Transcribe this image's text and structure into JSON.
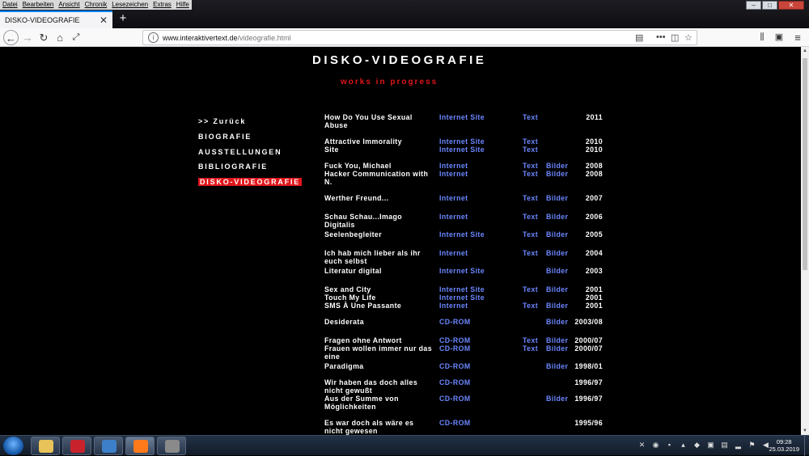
{
  "menubar": [
    "Datei",
    "Bearbeiten",
    "Ansicht",
    "Chronik",
    "Lesezeichen",
    "Extras",
    "Hilfe"
  ],
  "tab": {
    "title": "DISKO-VIDEOGRAFIE",
    "close": "✕"
  },
  "newtab": "+",
  "url": {
    "host": "www.interaktivertext.de",
    "path": "/videografie.html"
  },
  "page": {
    "title": "DISKO-VIDEOGRAFIE",
    "subtitle": "works in progress"
  },
  "sidenav": [
    {
      "label": ">> Zurück",
      "active": false
    },
    {
      "label": "BIOGRAFIE",
      "active": false
    },
    {
      "label": "AUSSTELLUNGEN",
      "active": false
    },
    {
      "label": "BIBLIOGRAFIE",
      "active": false
    },
    {
      "label": "DISKO-VIDEOGRAFIE",
      "active": true
    }
  ],
  "entries": [
    {
      "title": "How Do You Use Sexual Abuse",
      "media": "Internet Site",
      "text": "Text",
      "images": "",
      "year": "2011"
    },
    {
      "title": "Attractive Immorality",
      "media": "Internet Site",
      "text": "Text",
      "images": "",
      "year": "2010"
    },
    {
      "title": "Site",
      "media": "Internet Site",
      "text": "Text",
      "images": "",
      "year": "2010"
    },
    {
      "title": "Fuck You, Michael",
      "media": "Internet",
      "text": "Text",
      "images": "Bilder",
      "year": "2008"
    },
    {
      "title": "Hacker Communication with N.",
      "media": "Internet",
      "text": "Text",
      "images": "Bilder",
      "year": "2008"
    },
    {
      "title": "Werther Freund...",
      "media": "Internet",
      "text": "Text",
      "images": "Bilder",
      "year": "2007"
    },
    {
      "title": "Schau Schau...Imago Digitalis",
      "media": "Internet",
      "text": "Text",
      "images": "Bilder",
      "year": "2006"
    },
    {
      "title": "Seelenbegleiter",
      "media": "Internet Site",
      "text": "Text",
      "images": "Bilder",
      "year": "2005"
    },
    {
      "title": "Ich hab mich lieber als ihr euch selbst",
      "media": "Internet",
      "text": "Text",
      "images": "Bilder",
      "year": "2004"
    },
    {
      "title": "Literatur digital",
      "media": "Internet Site",
      "text": "",
      "images": "Bilder",
      "year": "2003"
    },
    {
      "title": "Sex and City",
      "media": "Internet Site",
      "text": "Text",
      "images": "Bilder",
      "year": "2001"
    },
    {
      "title": "Touch My Life",
      "media": "Internet Site",
      "text": "",
      "images": "",
      "year": "2001"
    },
    {
      "title": "SMS À Une Passante",
      "media": "Internet",
      "text": "Text",
      "images": "Bilder",
      "year": "2001"
    },
    {
      "title": "Desiderata",
      "media": "CD-ROM",
      "text": "",
      "images": "Bilder",
      "year": "2003/08"
    },
    {
      "title": "Fragen ohne Antwort",
      "media": "CD-ROM",
      "text": "Text",
      "images": "Bilder",
      "year": "2000/07"
    },
    {
      "title": "Frauen wollen immer nur das eine",
      "media": "CD-ROM",
      "text": "Text",
      "images": "Bilder",
      "year": "2000/07"
    },
    {
      "title": "Paradigma",
      "media": "CD-ROM",
      "text": "",
      "images": "Bilder",
      "year": "1998/01"
    },
    {
      "title": "Wir haben das doch alles nicht gewußt",
      "media": "CD-ROM",
      "text": "",
      "images": "",
      "year": "1996/97"
    },
    {
      "title": "Aus der Summe von Möglichkeiten",
      "media": "CD-ROM",
      "text": "",
      "images": "Bilder",
      "year": "1996/97"
    },
    {
      "title": "Es war doch als wäre es nicht gewesen",
      "media": "CD-ROM",
      "text": "",
      "images": "",
      "year": "1995/96"
    }
  ],
  "taskbar": {
    "apps": [
      {
        "icon": "file-explorer-icon",
        "color": "#e8c35a"
      },
      {
        "icon": "filezilla-icon",
        "color": "#c8232c"
      },
      {
        "icon": "thunderbird-icon",
        "color": "#3d7fc9"
      },
      {
        "icon": "firefox-icon",
        "color": "#ff7a1a"
      },
      {
        "icon": "eye-app-icon",
        "color": "#8a8a8a"
      }
    ],
    "clock": {
      "time": "09:28",
      "date": "25.03.2019"
    }
  }
}
